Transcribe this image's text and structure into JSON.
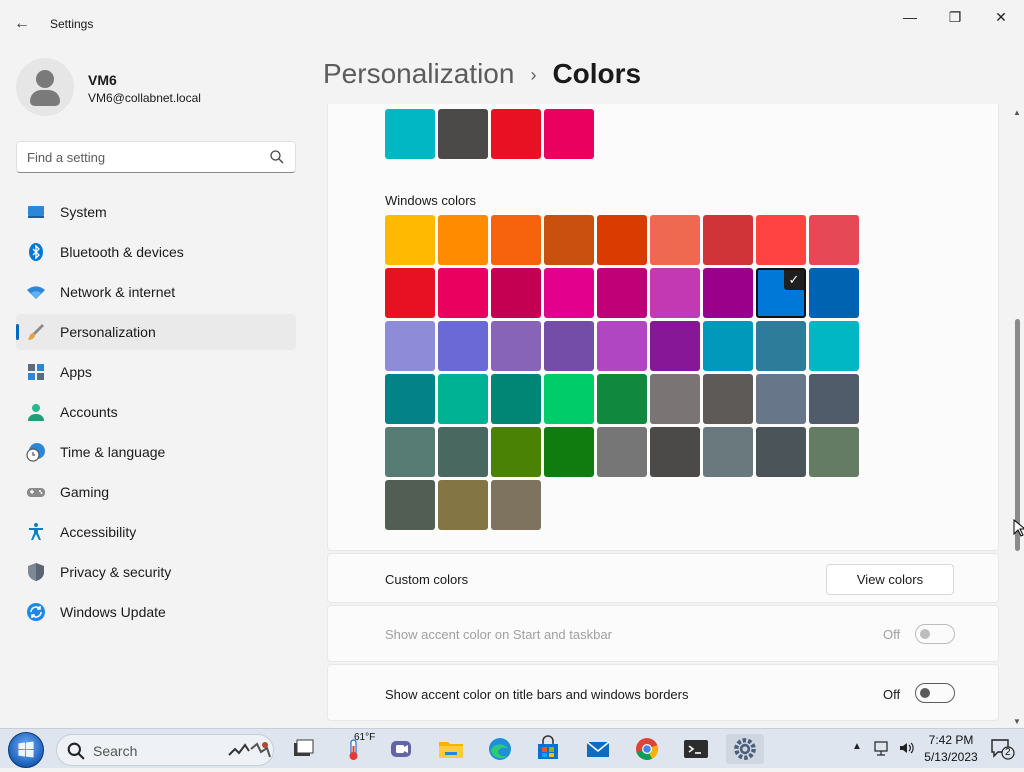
{
  "window": {
    "app_title": "Settings",
    "minimize_symbol": "—",
    "maximize_symbol": "❐",
    "close_symbol": "✕",
    "back_symbol": "←"
  },
  "profile": {
    "name": "VM6",
    "email": "VM6@collabnet.local"
  },
  "search": {
    "placeholder": "Find a setting"
  },
  "nav": {
    "items": [
      {
        "label": "System",
        "icon": "system-icon"
      },
      {
        "label": "Bluetooth & devices",
        "icon": "bluetooth-icon"
      },
      {
        "label": "Network & internet",
        "icon": "network-icon"
      },
      {
        "label": "Personalization",
        "icon": "personalization-icon",
        "active": true
      },
      {
        "label": "Apps",
        "icon": "apps-icon"
      },
      {
        "label": "Accounts",
        "icon": "accounts-icon"
      },
      {
        "label": "Time & language",
        "icon": "time-icon"
      },
      {
        "label": "Gaming",
        "icon": "gaming-icon"
      },
      {
        "label": "Accessibility",
        "icon": "accessibility-icon"
      },
      {
        "label": "Privacy & security",
        "icon": "privacy-icon"
      },
      {
        "label": "Windows Update",
        "icon": "update-icon"
      }
    ]
  },
  "header": {
    "parent": "Personalization",
    "separator": "›",
    "current": "Colors"
  },
  "recent_colors": [
    "#00b7c3",
    "#4c4a48",
    "#e81123",
    "#ea005e"
  ],
  "windows_colors": {
    "title": "Windows colors",
    "selected_index": 16,
    "check_symbol": "✓",
    "swatches": [
      "#ffb900",
      "#ff8c00",
      "#f7630c",
      "#ca5010",
      "#da3b01",
      "#ef6950",
      "#d13438",
      "#ff4343",
      "#e74856",
      "#e81123",
      "#ea005e",
      "#c30052",
      "#e3008c",
      "#bf0077",
      "#c239b3",
      "#9a0089",
      "#0078d7",
      "#0063b1",
      "#8e8cd8",
      "#6b69d6",
      "#8764b8",
      "#744da9",
      "#b146c2",
      "#881798",
      "#0099bc",
      "#2d7d9a",
      "#00b7c3",
      "#038387",
      "#00b294",
      "#018574",
      "#00cc6a",
      "#10893e",
      "#7a7574",
      "#5d5a58",
      "#68768a",
      "#515c6b",
      "#567c73",
      "#486860",
      "#498205",
      "#107c10",
      "#767676",
      "#4c4a48",
      "#69797e",
      "#4a5459",
      "#647c64",
      "#525e54",
      "#847545",
      "#7e735f"
    ]
  },
  "custom_colors": {
    "label": "Custom colors",
    "button": "View colors"
  },
  "accent_start": {
    "label": "Show accent color on Start and taskbar",
    "state": "Off",
    "enabled": false
  },
  "accent_titlebars": {
    "label": "Show accent color on title bars and windows borders",
    "state": "Off",
    "enabled": true
  },
  "taskbar": {
    "search_label": "Search",
    "weather_temp": "61°F",
    "time": "7:42 PM",
    "date": "5/13/2023",
    "notification_count": "2",
    "tray_expand_symbol": "▲",
    "apps": [
      "task-view-icon",
      "weather-icon",
      "teams-icon",
      "file-explorer-icon",
      "edge-icon",
      "store-icon",
      "mail-icon",
      "chrome-icon",
      "terminal-icon",
      "settings-icon"
    ]
  },
  "colors": {
    "accent": "#0067c0",
    "selected_swatch_border": "#111111"
  }
}
